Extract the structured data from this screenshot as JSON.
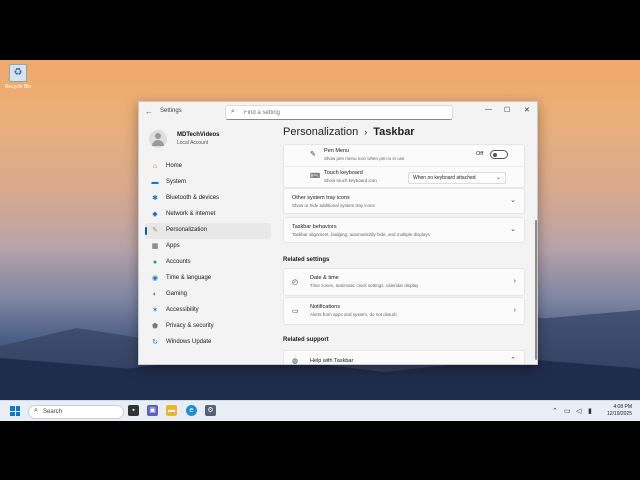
{
  "desktop": {
    "recycle_bin_label": "Recycle Bin"
  },
  "window": {
    "title": "Settings",
    "search_placeholder": "Find a setting",
    "controls": {
      "minimize": "—",
      "maximize": "☐",
      "close": "✕"
    }
  },
  "user": {
    "name": "MDTechVideos",
    "account": "Local Account"
  },
  "sidebar": {
    "items": [
      {
        "label": "Home",
        "icon": "home-icon",
        "glyph": "⌂",
        "color": "#c06a2b"
      },
      {
        "label": "System",
        "icon": "system-icon",
        "glyph": "▬",
        "color": "#0a78d4"
      },
      {
        "label": "Bluetooth & devices",
        "icon": "bluetooth-icon",
        "glyph": "✱",
        "color": "#0a78d4"
      },
      {
        "label": "Network & internet",
        "icon": "network-icon",
        "glyph": "◆",
        "color": "#0a78d4"
      },
      {
        "label": "Personalization",
        "icon": "brush-icon",
        "glyph": "✎",
        "color": "#d08a2b"
      },
      {
        "label": "Apps",
        "icon": "apps-icon",
        "glyph": "▦",
        "color": "#555"
      },
      {
        "label": "Accounts",
        "icon": "accounts-icon",
        "glyph": "●",
        "color": "#1ba37a"
      },
      {
        "label": "Time & language",
        "icon": "globe-icon",
        "glyph": "◉",
        "color": "#0a78d4"
      },
      {
        "label": "Gaming",
        "icon": "gaming-icon",
        "glyph": "◐",
        "color": "#777"
      },
      {
        "label": "Accessibility",
        "icon": "accessibility-icon",
        "glyph": "✶",
        "color": "#0a78d4"
      },
      {
        "label": "Privacy & security",
        "icon": "shield-icon",
        "glyph": "⬟",
        "color": "#777"
      },
      {
        "label": "Windows Update",
        "icon": "update-icon",
        "glyph": "↻",
        "color": "#0a78d4"
      }
    ],
    "active_index": 4
  },
  "breadcrumb": {
    "parent": "Personalization",
    "separator": "›",
    "current": "Taskbar"
  },
  "settings": {
    "pen_menu": {
      "title": "Pen Menu",
      "subtitle": "Show pen menu icon when pen is in use",
      "toggle_label": "Off"
    },
    "touch_keyboard": {
      "title": "Touch keyboard",
      "subtitle": "Show touch keyboard icon",
      "value": "When no keyboard attached"
    },
    "other_tray": {
      "title": "Other system tray icons",
      "subtitle": "Show or hide additional system tray icons"
    },
    "behaviors": {
      "title": "Taskbar behaviors",
      "subtitle": "Taskbar alignment, badging, automatically hide, and multiple displays"
    }
  },
  "related_settings": {
    "heading": "Related settings",
    "items": [
      {
        "title": "Date & time",
        "subtitle": "Time zones, automatic clock settings, calendar display"
      },
      {
        "title": "Notifications",
        "subtitle": "Alerts from apps and system, do not disturb"
      }
    ]
  },
  "related_support": {
    "heading": "Related support",
    "items": [
      {
        "title": "Help with Taskbar"
      }
    ]
  },
  "taskbar": {
    "search_label": "Search",
    "time": "4:08 PM",
    "date": "12/19/2025"
  }
}
